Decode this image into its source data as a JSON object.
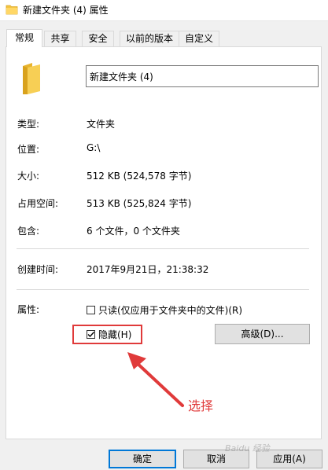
{
  "window": {
    "title": "新建文件夹 (4) 属性"
  },
  "tabs": [
    {
      "label": "常规",
      "active": true
    },
    {
      "label": "共享",
      "active": false
    },
    {
      "label": "安全",
      "active": false
    },
    {
      "label": "以前的版本",
      "active": false
    },
    {
      "label": "自定义",
      "active": false
    }
  ],
  "general": {
    "folder_name": "新建文件夹 (4)",
    "type_label": "类型:",
    "type_value": "文件夹",
    "location_label": "位置:",
    "location_value": "G:\\",
    "size_label": "大小:",
    "size_value": "512 KB (524,578 字节)",
    "disk_size_label": "占用空间:",
    "disk_size_value": "513 KB (525,824 字节)",
    "contains_label": "包含:",
    "contains_value": "6 个文件，0 个文件夹",
    "created_label": "创建时间:",
    "created_value": "2017年9月21日，21:38:32",
    "attributes_label": "属性:",
    "readonly_label": "只读(仅应用于文件夹中的文件)(R)",
    "readonly_checked": false,
    "hidden_label": "隐藏(H)",
    "hidden_checked": true,
    "advanced_button": "高级(D)..."
  },
  "footer": {
    "ok": "确定",
    "cancel": "取消",
    "apply": "应用(A)"
  },
  "annotation": {
    "text": "选择",
    "color": "#e03a3a"
  },
  "watermark": {
    "text": "Baidu 经验"
  },
  "colors": {
    "folder": "#f5c542",
    "accent": "#0078d7",
    "annotation": "#e03a3a"
  },
  "icons": {
    "title_icon": "folder-icon",
    "large_icon": "folder-icon",
    "check_mark": "check-icon"
  }
}
